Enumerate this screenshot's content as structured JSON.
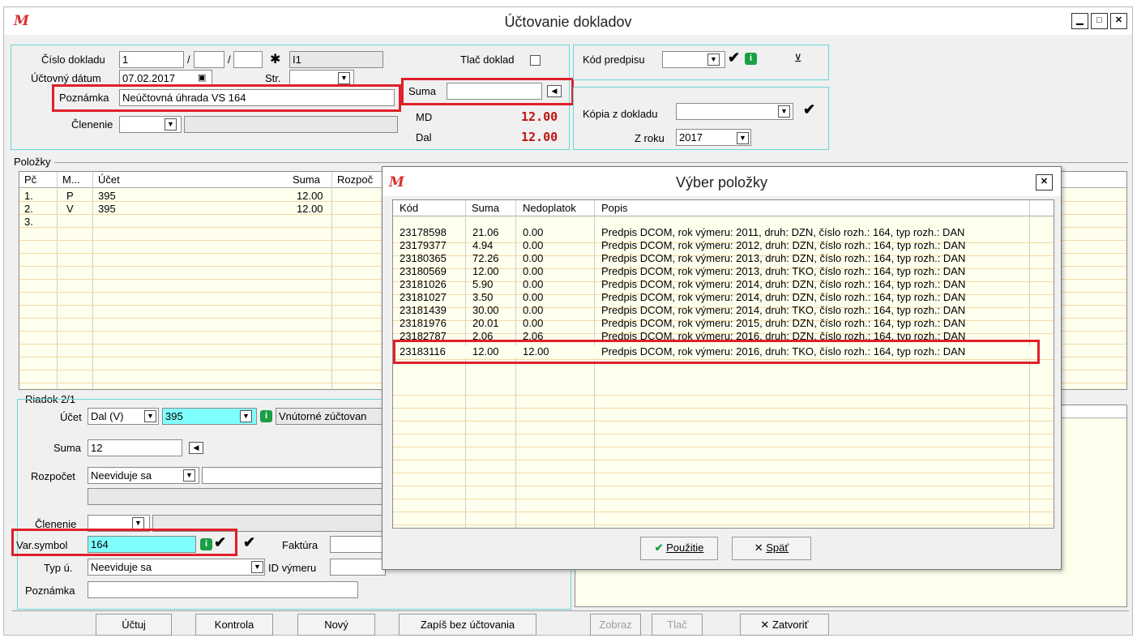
{
  "window": {
    "title": "Účtovanie dokladov",
    "logo": "M"
  },
  "header": {
    "cislo_dokladu_label": "Číslo dokladu",
    "cislo_value": "1",
    "slash": "/",
    "cislo_display": "I1",
    "uctovny_datum_label": "Účtovný dátum",
    "uctovny_datum_value": "07.02.2017",
    "str_label": "Str.",
    "poznamka_label": "Poznámka",
    "poznamka_value": "Neúčtovná úhrada VS 164",
    "clenenie_label": "Členenie",
    "tlac_doklad_label": "Tlač doklad",
    "suma_label": "Suma",
    "md_label": "MD",
    "md_value": "12.00",
    "dal_label": "Dal",
    "dal_value": "12.00",
    "kod_predpisu_label": "Kód predpisu",
    "kopia_label": "Kópia z dokladu",
    "z_roku_label": "Z roku",
    "z_roku_value": "2017"
  },
  "polozky": {
    "title": "Položky",
    "columns": [
      "Pč",
      "M...",
      "Účet",
      "Suma",
      "Rozpoč"
    ],
    "rows": [
      {
        "pc": "1.",
        "m": "P",
        "ucet": "395",
        "suma": "12.00"
      },
      {
        "pc": "2.",
        "m": "V",
        "ucet": "395",
        "suma": "12.00"
      },
      {
        "pc": "3.",
        "m": "",
        "ucet": "",
        "suma": ""
      }
    ]
  },
  "riadok": {
    "title": "Riadok 2/1",
    "ucet_label": "Účet",
    "ucet_side": "Dal (V)",
    "ucet_value": "395",
    "ucet_name": "Vnútorné zúčtovan",
    "suma_label": "Suma",
    "suma_value": "12",
    "rozpocet_label": "Rozpočet",
    "rozpocet_value": "Neeviduje sa",
    "clenenie_label": "Členenie",
    "var_symbol_label": "Var.symbol",
    "var_symbol_value": "164",
    "faktura_label": "Faktúra",
    "typ_u_label": "Typ ú.",
    "typ_u_value": "Neeviduje sa",
    "id_vymeru_label": "ID výmeru",
    "poznamka_label": "Poznámka"
  },
  "buttons": {
    "uctuj": "Účtuj",
    "kontrola": "Kontrola",
    "novy": "Nový",
    "zapis": "Zapíš bez účtovania",
    "zobraz": "Zobraz",
    "tlac": "Tlač",
    "zatvorit": "Zatvoriť"
  },
  "dialog": {
    "title": "Výber položky",
    "columns": [
      "Kód",
      "Suma",
      "Nedoplatok",
      "Popis"
    ],
    "rows": [
      {
        "kod": "23178598",
        "suma": "21.06",
        "ned": "0.00",
        "popis": "Predpis DCOM, rok výmeru: 2011, druh: DZN, číslo rozh.: 164, typ rozh.: DAN"
      },
      {
        "kod": "23179377",
        "suma": "4.94",
        "ned": "0.00",
        "popis": "Predpis DCOM, rok výmeru: 2012, druh: DZN, číslo rozh.: 164, typ rozh.: DAN"
      },
      {
        "kod": "23180365",
        "suma": "72.26",
        "ned": "0.00",
        "popis": "Predpis DCOM, rok výmeru: 2013, druh: DZN, číslo rozh.: 164, typ rozh.: DAN"
      },
      {
        "kod": "23180569",
        "suma": "12.00",
        "ned": "0.00",
        "popis": "Predpis DCOM, rok výmeru: 2013, druh: TKO, číslo rozh.: 164, typ rozh.: DAN"
      },
      {
        "kod": "23181026",
        "suma": "5.90",
        "ned": "0.00",
        "popis": "Predpis DCOM, rok výmeru: 2014, druh: DZN, číslo rozh.: 164, typ rozh.: DAN"
      },
      {
        "kod": "23181027",
        "suma": "3.50",
        "ned": "0.00",
        "popis": "Predpis DCOM, rok výmeru: 2014, druh: DZN, číslo rozh.: 164, typ rozh.: DAN"
      },
      {
        "kod": "23181439",
        "suma": "30.00",
        "ned": "0.00",
        "popis": "Predpis DCOM, rok výmeru: 2014, druh: TKO, číslo rozh.: 164, typ rozh.: DAN"
      },
      {
        "kod": "23181976",
        "suma": "20.01",
        "ned": "0.00",
        "popis": "Predpis DCOM, rok výmeru: 2015, druh: DZN, číslo rozh.: 164, typ rozh.: DAN"
      },
      {
        "kod": "23182787",
        "suma": "2.06",
        "ned": "2.06",
        "popis": "Predpis DCOM, rok výmeru: 2016, druh: DZN, číslo rozh.: 164, typ rozh.: DAN"
      },
      {
        "kod": "23183116",
        "suma": "12.00",
        "ned": "12.00",
        "popis": "Predpis DCOM, rok výmeru: 2016, druh: TKO, číslo rozh.: 164, typ rozh.: DAN"
      }
    ],
    "use_button": "Použitie",
    "back_button": "Späť"
  },
  "colors": {
    "highlight_red": "#e0202a",
    "amount_red": "#c01414",
    "cyan": "#80ffff",
    "grid_bg": "#ffffee"
  }
}
